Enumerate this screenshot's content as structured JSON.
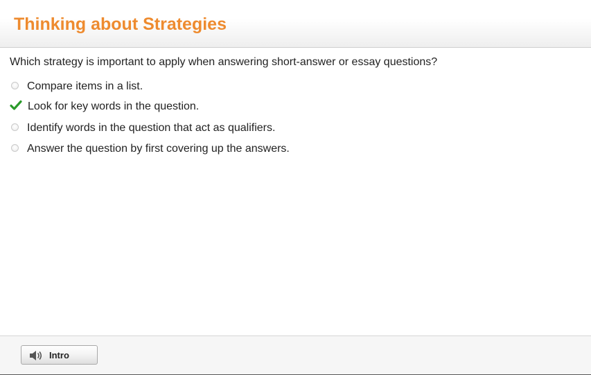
{
  "header": {
    "title": "Thinking about Strategies",
    "title_color": "#ee8b2f"
  },
  "question": {
    "text": "Which strategy is important to apply when answering short-answer or essay questions?"
  },
  "options": [
    {
      "label": "Compare items in a list.",
      "selected": false,
      "icon": "radio-icon"
    },
    {
      "label": "Look for key words in the question.",
      "selected": true,
      "icon": "checkmark-icon",
      "icon_color": "#2a9a2a"
    },
    {
      "label": "Identify words in the question that act as qualifiers.",
      "selected": false,
      "icon": "radio-icon"
    },
    {
      "label": "Answer the question by first covering up the answers.",
      "selected": false,
      "icon": "radio-icon"
    }
  ],
  "footer": {
    "intro_button_label": "Intro",
    "intro_button_icon": "speaker-icon"
  }
}
